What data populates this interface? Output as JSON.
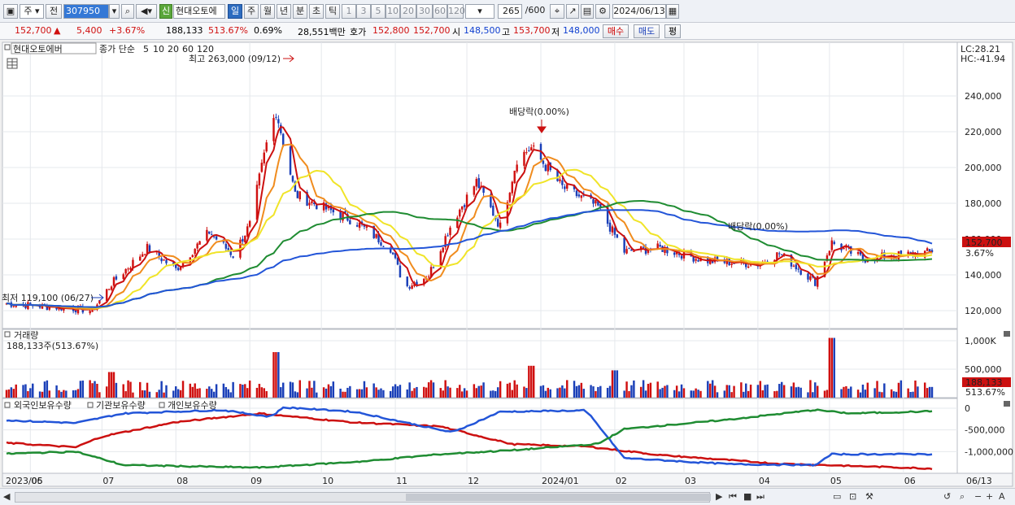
{
  "toolbar": {
    "period_type": "주",
    "prev": "전",
    "code": "307950",
    "stock_name": "현대오토에",
    "new_badge": "신",
    "periods": [
      "일",
      "주",
      "월",
      "년",
      "분",
      "초",
      "틱"
    ],
    "active_period": "일",
    "intervals": [
      "1",
      "3",
      "5",
      "10",
      "20",
      "30",
      "60",
      "120"
    ],
    "count": "265",
    "count_max": "/600",
    "date": "2024/06/13"
  },
  "quote": {
    "price": "152,700",
    "arrow": "▲",
    "change": "5,400",
    "change_pct": "+3.67%",
    "volume": "188,133",
    "vol_ratio": "513.67%",
    "turnover": "0.69%",
    "amount": "28,551백만",
    "ask_label": "호가",
    "ask": "152,800",
    "bid": "152,700",
    "open_label": "시",
    "open": "148,500",
    "high_label": "고",
    "high": "153,700",
    "low_label": "저",
    "low": "148,000",
    "buy_label": "매수",
    "sell_label": "매도",
    "eval_label": "평"
  },
  "price_panel": {
    "legend_name": "현대오토에버",
    "legend_type": "종가 단순",
    "ma_labels": [
      "5",
      "10",
      "20",
      "60",
      "120"
    ],
    "ma_colors": [
      "#cc1010",
      "#f08c1e",
      "#f0e428",
      "#1f8c32",
      "#2355d8"
    ],
    "max_annot": "최고 263,000 (09/12)",
    "min_annot": "최저 119,100 (06/27)",
    "div_annot": "배당락(0.00%)",
    "div_annot2": "배당락(0.00%)",
    "lc": "LC:28.21",
    "hc": "HC:-41.94",
    "cur_price": "152,700",
    "cur_pct": "3.67%",
    "y_ticks": [
      "120,000",
      "140,000",
      "160,000",
      "180,000",
      "200,000",
      "220,000",
      "240,000"
    ]
  },
  "volume_panel": {
    "title": "거래량",
    "info": "188,133주(513.67%)",
    "y_ticks": [
      "500,000",
      "1,000K"
    ],
    "cur_vol": "188,133",
    "cur_pct": "513.67%"
  },
  "holders_panel": {
    "foreign": "외국인보유수량",
    "institution": "기관보유수량",
    "individual": "개인보유수량",
    "colors": {
      "foreign": "#cc1010",
      "institution": "#2355d8",
      "individual": "#1f8c32"
    },
    "y_ticks": [
      "0",
      "-500,000",
      "-1,000,000"
    ]
  },
  "x_axis": [
    "2023/05",
    "06",
    "07",
    "08",
    "09",
    "10",
    "11",
    "12",
    "2024/01",
    "02",
    "03",
    "04",
    "05",
    "06"
  ],
  "x_axis_end": "06/13",
  "chart_data": {
    "type": "candlestick",
    "price_key": [
      [
        "2023-05-22",
        124000
      ],
      [
        "2023-06-01",
        123000
      ],
      [
        "2023-06-20",
        121000
      ],
      [
        "2023-06-27",
        120000
      ],
      [
        "2023-07-05",
        135000
      ],
      [
        "2023-07-20",
        155000
      ],
      [
        "2023-08-01",
        143000
      ],
      [
        "2023-08-15",
        164000
      ],
      [
        "2023-08-25",
        151000
      ],
      [
        "2023-09-01",
        168000
      ],
      [
        "2023-09-08",
        213000
      ],
      [
        "2023-09-12",
        232000
      ],
      [
        "2023-09-20",
        185000
      ],
      [
        "2023-10-01",
        178000
      ],
      [
        "2023-10-15",
        170000
      ],
      [
        "2023-10-30",
        155000
      ],
      [
        "2023-11-05",
        133000
      ],
      [
        "2023-11-15",
        140000
      ],
      [
        "2023-11-25",
        170000
      ],
      [
        "2023-12-05",
        192000
      ],
      [
        "2023-12-15",
        167000
      ],
      [
        "2023-12-22",
        205000
      ],
      [
        "2023-12-28",
        211000
      ],
      [
        "2024-01-10",
        189000
      ],
      [
        "2024-01-25",
        178000
      ],
      [
        "2024-02-05",
        153000
      ],
      [
        "2024-02-20",
        155000
      ],
      [
        "2024-03-10",
        148000
      ],
      [
        "2024-04-01",
        146000
      ],
      [
        "2024-04-10",
        152000
      ],
      [
        "2024-04-25",
        136000
      ],
      [
        "2024-05-02",
        158000
      ],
      [
        "2024-05-15",
        149000
      ],
      [
        "2024-06-13",
        152700
      ]
    ],
    "volume_spikes": [
      [
        "2023-07-05",
        450000
      ],
      [
        "2023-09-12",
        800000
      ],
      [
        "2023-12-28",
        560000
      ],
      [
        "2024-02-01",
        480000
      ],
      [
        "2024-05-02",
        1050000
      ],
      [
        "2024-06-13",
        188133
      ]
    ],
    "ylim_price": [
      110000,
      270000
    ],
    "ylim_volume": [
      0,
      1100000
    ],
    "holders": {
      "foreign": [
        [
          "2023-05-22",
          -800000
        ],
        [
          "2023-06-20",
          -900000
        ],
        [
          "2023-07-01",
          -650000
        ],
        [
          "2023-08-01",
          -320000
        ],
        [
          "2023-09-05",
          -120000
        ],
        [
          "2023-10-15",
          -330000
        ],
        [
          "2023-11-20",
          -420000
        ],
        [
          "2023-12-20",
          -830000
        ],
        [
          "2024-01-20",
          -880000
        ],
        [
          "2024-02-20",
          -1080000
        ],
        [
          "2024-04-10",
          -1280000
        ],
        [
          "2024-05-10",
          -1330000
        ],
        [
          "2024-06-13",
          -1390000
        ]
      ],
      "institution": [
        [
          "2023-05-22",
          -280000
        ],
        [
          "2023-06-20",
          -340000
        ],
        [
          "2023-07-10",
          -120000
        ],
        [
          "2023-08-20",
          -40000
        ],
        [
          "2023-09-10",
          -200000
        ],
        [
          "2023-09-15",
          20000
        ],
        [
          "2023-10-15",
          -80000
        ],
        [
          "2023-11-25",
          -560000
        ],
        [
          "2023-12-15",
          -80000
        ],
        [
          "2024-01-20",
          -50000
        ],
        [
          "2024-02-05",
          -1150000
        ],
        [
          "2024-03-20",
          -1290000
        ],
        [
          "2024-04-25",
          -1310000
        ],
        [
          "2024-05-02",
          -1060000
        ],
        [
          "2024-06-13",
          -1060000
        ]
      ],
      "individual": [
        [
          "2023-05-22",
          -1050000
        ],
        [
          "2023-06-20",
          -1000000
        ],
        [
          "2023-07-10",
          -1310000
        ],
        [
          "2023-09-05",
          -1370000
        ],
        [
          "2023-10-20",
          -1220000
        ],
        [
          "2023-11-20",
          -1060000
        ],
        [
          "2023-12-20",
          -970000
        ],
        [
          "2024-01-25",
          -820000
        ],
        [
          "2024-02-05",
          -480000
        ],
        [
          "2024-03-20",
          -260000
        ],
        [
          "2024-04-25",
          -40000
        ],
        [
          "2024-05-10",
          -120000
        ],
        [
          "2024-06-13",
          -70000
        ]
      ]
    },
    "ma_series": [
      "MA5",
      "MA10",
      "MA20",
      "MA60",
      "MA120"
    ]
  }
}
